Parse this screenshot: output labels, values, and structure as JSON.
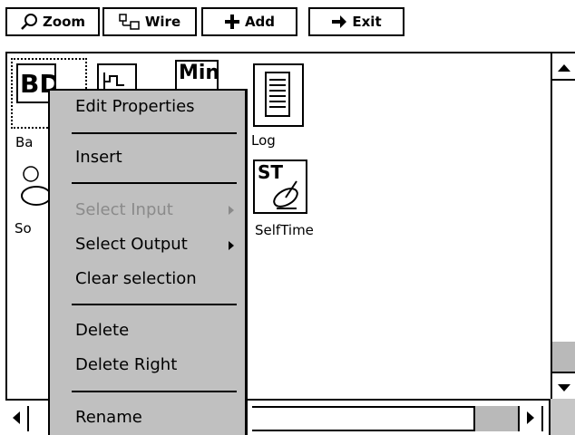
{
  "toolbar": {
    "zoom_label": "Zoom",
    "wire_label": "Wire",
    "add_label": "Add",
    "exit_label": "Exit"
  },
  "blocks": {
    "b1_icon_text": "BD",
    "b1_label": "Ba",
    "b2_icon_text": "",
    "b3_icon_text": "Min",
    "log_label": "Log",
    "b5_label": "So",
    "selftime_icon_text": "ST",
    "selftime_label": "SelfTime"
  },
  "context_menu": {
    "edit_properties": "Edit Properties",
    "insert": "Insert",
    "select_input": "Select Input",
    "select_output": "Select Output",
    "clear_selection": "Clear selection",
    "delete": "Delete",
    "delete_right": "Delete Right",
    "rename": "Rename"
  },
  "colors": {
    "menu_bg": "#c0c0c0",
    "disabled_text": "#8a8a8a"
  },
  "icons": [
    "magnifier-icon",
    "wire-icon",
    "plus-icon",
    "arrow-right-icon",
    "scroll-up-icon",
    "scroll-down-icon",
    "scroll-left-icon",
    "scroll-right-icon",
    "submenu-arrow-icon"
  ]
}
